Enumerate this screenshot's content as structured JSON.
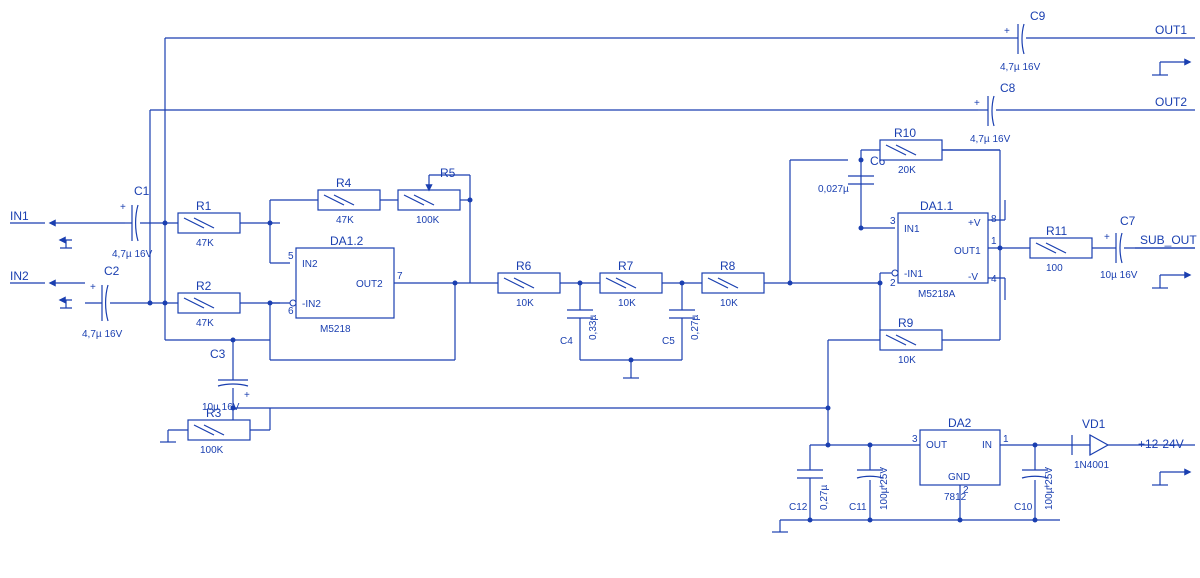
{
  "io": {
    "in1": "IN1",
    "in2": "IN2",
    "out1": "OUT1",
    "out2": "OUT2",
    "subout": "SUB_OUT",
    "power": "+12-24V"
  },
  "C1": {
    "ref": "C1",
    "val": "4,7µ 16V"
  },
  "C2": {
    "ref": "C2",
    "val": "4,7µ 16V"
  },
  "C3": {
    "ref": "C3",
    "val": "10µ 16V"
  },
  "C4": {
    "ref": "C4",
    "val": "0,33µ"
  },
  "C5": {
    "ref": "C5",
    "val": "0,27µ"
  },
  "C6": {
    "ref": "C6",
    "val": "0,027µ"
  },
  "C7": {
    "ref": "C7",
    "val": "10µ 16V"
  },
  "C8": {
    "ref": "C8",
    "val": "4,7µ 16V"
  },
  "C9": {
    "ref": "C9",
    "val": "4,7µ 16V"
  },
  "C10": {
    "ref": "C10",
    "val": "100µ 25V"
  },
  "C11": {
    "ref": "C11",
    "val": "100µ 25V"
  },
  "C12": {
    "ref": "C12",
    "val": "0,27µ"
  },
  "R1": {
    "ref": "R1",
    "val": "47K"
  },
  "R2": {
    "ref": "R2",
    "val": "47K"
  },
  "R3": {
    "ref": "R3",
    "val": "100K"
  },
  "R4": {
    "ref": "R4",
    "val": "47K"
  },
  "R5": {
    "ref": "R5",
    "val": "100K"
  },
  "R6": {
    "ref": "R6",
    "val": "10K"
  },
  "R7": {
    "ref": "R7",
    "val": "10K"
  },
  "R8": {
    "ref": "R8",
    "val": "10K"
  },
  "R9": {
    "ref": "R9",
    "val": "10K"
  },
  "R10": {
    "ref": "R10",
    "val": "20K"
  },
  "R11": {
    "ref": "R11",
    "val": "100"
  },
  "DA1_1": {
    "ref": "DA1.1",
    "part": "M5218A",
    "p_in1": "IN1",
    "p_nin1": "-IN1",
    "p_out1": "OUT1",
    "p_pv": "+V",
    "p_nv": "-V",
    "pin3": "3",
    "pin2": "2",
    "pin1": "1",
    "pin8": "8",
    "pin4": "4"
  },
  "DA1_2": {
    "ref": "DA1.2",
    "part": "M5218",
    "p_in2": "IN2",
    "p_nin2": "-IN2",
    "p_out2": "OUT2",
    "pin5": "5",
    "pin6": "6",
    "pin7": "7"
  },
  "DA2": {
    "ref": "DA2",
    "part": "7812",
    "p_out": "OUT",
    "p_in": "IN",
    "p_gnd": "GND",
    "pin1": "1",
    "pin2": "2",
    "pin3": "3"
  },
  "VD1": {
    "ref": "VD1",
    "part": "1N4001"
  },
  "plus": "+"
}
